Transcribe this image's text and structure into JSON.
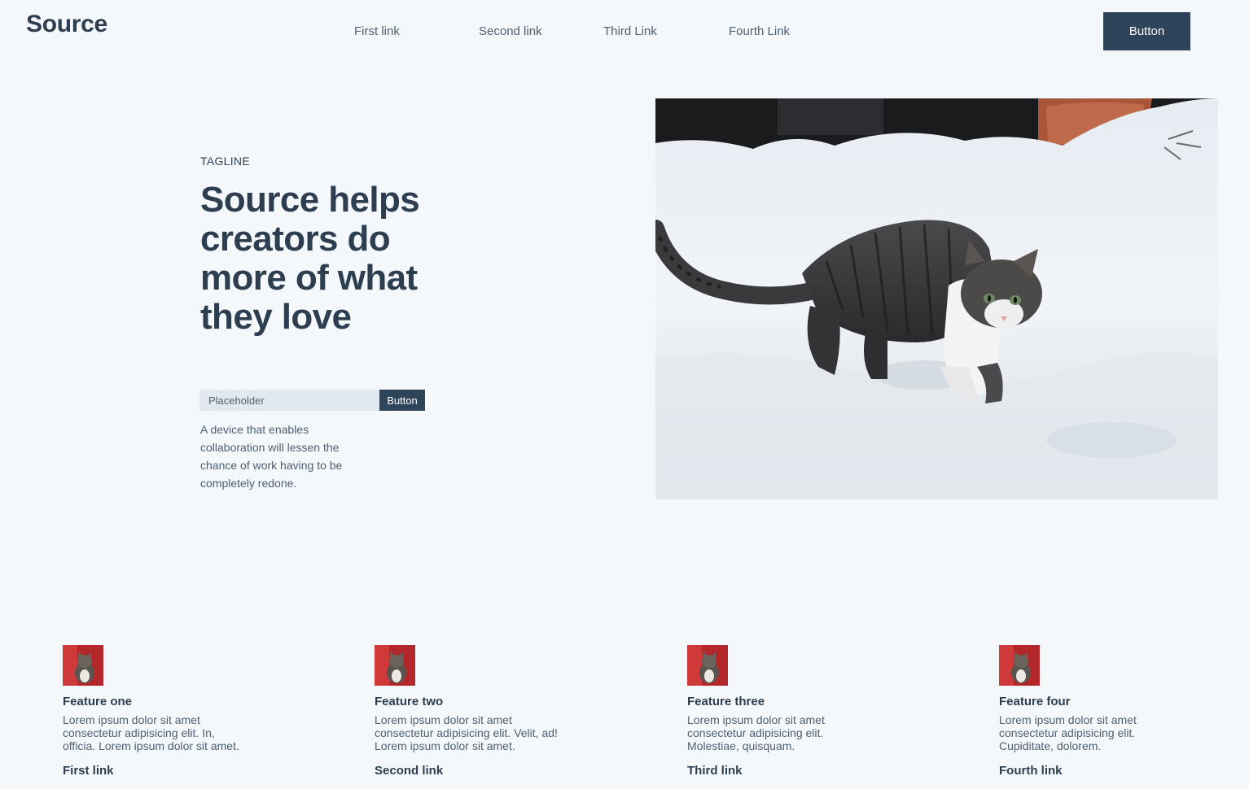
{
  "header": {
    "logo": "Source",
    "nav": [
      "First link",
      "Second link",
      "Third Link",
      "Fourth Link"
    ],
    "button_label": "Button"
  },
  "hero": {
    "tagline": "TAGLINE",
    "title": "Source helps creators do more of what they love",
    "input_placeholder": "Placeholder",
    "button_label": "Button",
    "description": "A device that enables collaboration will lessen the chance of work having to be completely redone.",
    "image": "cat-in-snow-photo"
  },
  "features": [
    {
      "title": "Feature one",
      "text": "Lorem ipsum dolor sit amet consectetur adipisicing elit. In, officia. Lorem ipsum dolor sit amet.",
      "link": "First link"
    },
    {
      "title": "Feature two",
      "text": "Lorem ipsum dolor sit amet consectetur adipisicing elit. Velit, ad! Lorem ipsum dolor sit amet.",
      "link": "Second link"
    },
    {
      "title": "Feature three",
      "text": "Lorem ipsum dolor sit amet consectetur adipisicing elit. Molestiae, quisquam.",
      "link": "Third link"
    },
    {
      "title": "Feature four",
      "text": "Lorem ipsum dolor sit amet consectetur adipisicing elit. Cupiditate, dolorem.",
      "link": "Fourth link"
    }
  ],
  "colors": {
    "background": "#f5f8fb",
    "primary": "#2e445a",
    "text": "#2c3e50",
    "muted": "#4c5f72",
    "input_bg": "#e2e8ef"
  }
}
